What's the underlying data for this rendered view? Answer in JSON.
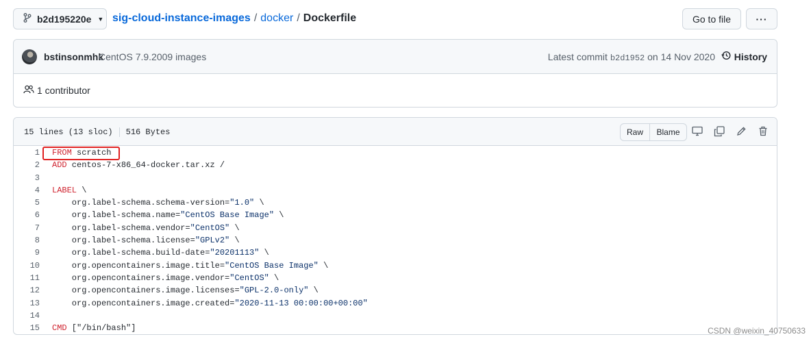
{
  "topbar": {
    "branch": "b2d195220e",
    "breadcrumb": {
      "repo": "sig-cloud-instance-images",
      "sep1": "/",
      "dir": "docker",
      "sep2": "/",
      "file": "Dockerfile"
    },
    "goto_label": "Go to file",
    "more_label": "···"
  },
  "commit": {
    "author": "bstinsonmhk",
    "message": "CentOS 7.9.2009 images",
    "latest_prefix": "Latest commit",
    "sha": "b2d1952",
    "date": "on 14 Nov 2020",
    "history_label": "History",
    "contributors": "1 contributor"
  },
  "file": {
    "lines_info": "15 lines (13 sloc)",
    "size": "516 Bytes",
    "raw_label": "Raw",
    "blame_label": "Blame"
  },
  "code_lines": [
    {
      "num": "1",
      "kw": "FROM",
      "rest": " scratch",
      "str": "",
      "tail": ""
    },
    {
      "num": "2",
      "kw": "ADD",
      "rest": " centos-7-x86_64-docker.tar.xz /",
      "str": "",
      "tail": ""
    },
    {
      "num": "3",
      "kw": "",
      "rest": "",
      "str": "",
      "tail": ""
    },
    {
      "num": "4",
      "kw": "LABEL",
      "rest": " \\",
      "str": "",
      "tail": ""
    },
    {
      "num": "5",
      "kw": "",
      "rest": "    org.label-schema.schema-version=",
      "str": "\"1.0\"",
      "tail": " \\"
    },
    {
      "num": "6",
      "kw": "",
      "rest": "    org.label-schema.name=",
      "str": "\"CentOS Base Image\"",
      "tail": " \\"
    },
    {
      "num": "7",
      "kw": "",
      "rest": "    org.label-schema.vendor=",
      "str": "\"CentOS\"",
      "tail": " \\"
    },
    {
      "num": "8",
      "kw": "",
      "rest": "    org.label-schema.license=",
      "str": "\"GPLv2\"",
      "tail": " \\"
    },
    {
      "num": "9",
      "kw": "",
      "rest": "    org.label-schema.build-date=",
      "str": "\"20201113\"",
      "tail": " \\"
    },
    {
      "num": "10",
      "kw": "",
      "rest": "    org.opencontainers.image.title=",
      "str": "\"CentOS Base Image\"",
      "tail": " \\"
    },
    {
      "num": "11",
      "kw": "",
      "rest": "    org.opencontainers.image.vendor=",
      "str": "\"CentOS\"",
      "tail": " \\"
    },
    {
      "num": "12",
      "kw": "",
      "rest": "    org.opencontainers.image.licenses=",
      "str": "\"GPL-2.0-only\"",
      "tail": " \\"
    },
    {
      "num": "13",
      "kw": "",
      "rest": "    org.opencontainers.image.created=",
      "str": "\"2020-11-13 00:00:00+00:00\"",
      "tail": ""
    },
    {
      "num": "14",
      "kw": "",
      "rest": "",
      "str": "",
      "tail": ""
    },
    {
      "num": "15",
      "kw": "CMD",
      "rest": " [\"/bin/bash\"]",
      "str": "",
      "tail": ""
    }
  ],
  "watermark": "CSDN @weixin_40750633",
  "colors": {
    "link": "#0969da",
    "keyword": "#cf222e",
    "string": "#0a3069",
    "highlight": "#e02020"
  },
  "icons": [
    "git-branch-icon",
    "caret-down-icon",
    "kebab-icon",
    "history-icon",
    "people-icon",
    "desktop-icon",
    "copy-icon",
    "pencil-icon",
    "trash-icon"
  ]
}
